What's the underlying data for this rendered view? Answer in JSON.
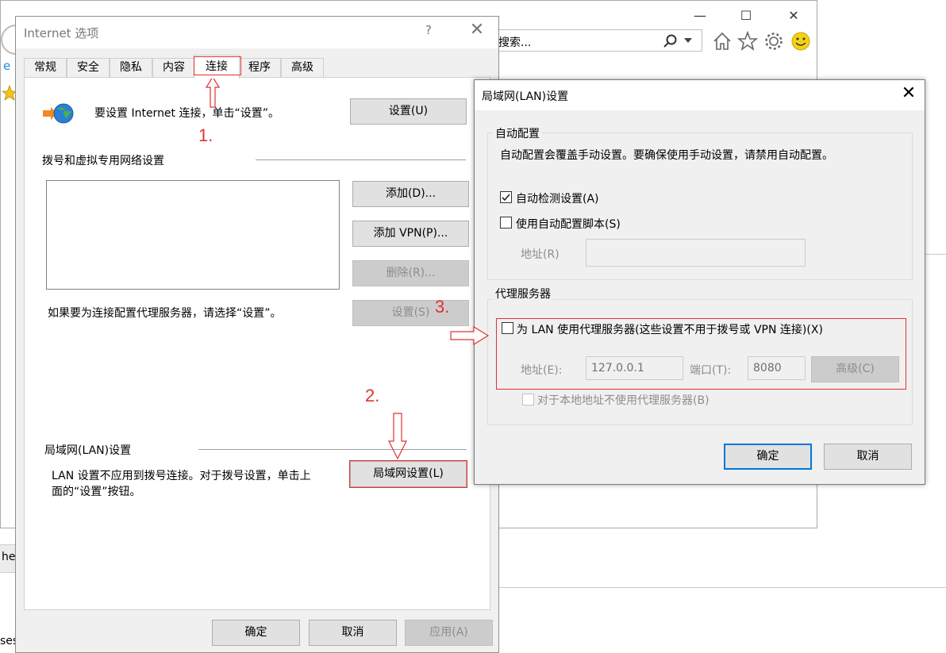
{
  "browser": {
    "search_placeholder": "搜索..."
  },
  "background": {
    "left_text_1": "he",
    "left_text_2": "ses"
  },
  "inet": {
    "title": "Internet 选项",
    "help": "?",
    "close": "✕",
    "tabs": [
      {
        "label": "常规"
      },
      {
        "label": "安全"
      },
      {
        "label": "隐私"
      },
      {
        "label": "内容"
      },
      {
        "label": "连接"
      },
      {
        "label": "程序"
      },
      {
        "label": "高级"
      }
    ],
    "setup_text": "要设置 Internet 连接，单击“设置”。",
    "setup_button": "设置(U)",
    "dialup_section": "拨号和虚拟专用网络设置",
    "add_button": "添加(D)...",
    "add_vpn_button": "添加 VPN(P)...",
    "remove_button": "删除(R)...",
    "proxy_hint": "如果要为连接配置代理服务器，请选择“设置”。",
    "settings_button": "设置(S)",
    "lan_section": "局域网(LAN)设置",
    "lan_text_1": "LAN 设置不应用到拨号连接。对于拨号设置，单击上",
    "lan_text_2": "面的“设置”按钮。",
    "lan_button": "局域网设置(L)",
    "ok": "确定",
    "cancel": "取消",
    "apply": "应用(A)"
  },
  "lan": {
    "title": "局域网(LAN)设置",
    "close": "✕",
    "auto_group": "自动配置",
    "auto_desc": "自动配置会覆盖手动设置。要确保使用手动设置，请禁用自动配置。",
    "auto_detect": {
      "label": "自动检测设置(A)",
      "checked": true
    },
    "auto_script": {
      "label": "使用自动配置脚本(S)",
      "checked": false
    },
    "script_address_label": "地址(R)",
    "script_address_value": "",
    "proxy_group": "代理服务器",
    "use_proxy": {
      "label": "为 LAN 使用代理服务器(这些设置不用于拨号或 VPN 连接)(X)",
      "checked": false
    },
    "address_label": "地址(E):",
    "address_value": "127.0.0.1",
    "port_label": "端口(T):",
    "port_value": "8080",
    "advanced_button": "高级(C)",
    "bypass_local": {
      "label": "对于本地地址不使用代理服务器(B)",
      "checked": false
    },
    "ok": "确定",
    "cancel": "取消"
  },
  "annotations": {
    "step1": "1.",
    "step2": "2.",
    "step3": "3."
  },
  "colors": {
    "annotation_red": "#e23131",
    "focus_blue": "#0078d7",
    "dialog_bg": "#f0f0f0"
  }
}
